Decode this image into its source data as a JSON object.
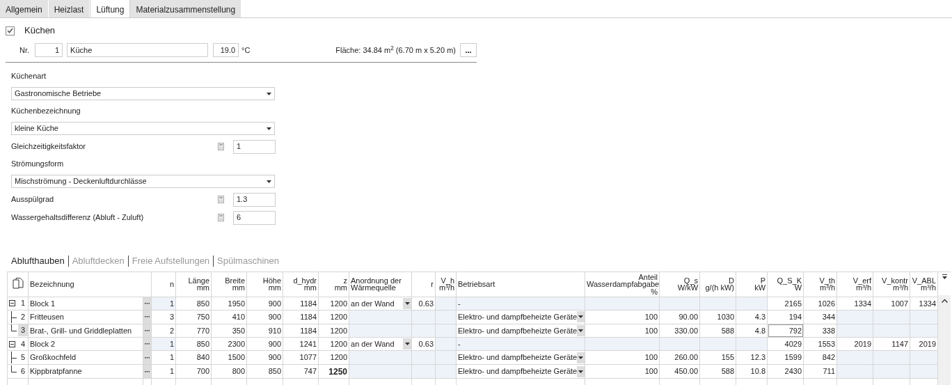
{
  "tabs": [
    {
      "label": "Allgemein",
      "selected": false
    },
    {
      "label": "Heizlast",
      "selected": false
    },
    {
      "label": "Lüftung",
      "selected": true
    },
    {
      "label": "Materialzusammenstellung",
      "selected": false
    }
  ],
  "room": {
    "checked": true,
    "title": "Küchen",
    "nr_label": "Nr.",
    "nr": "1",
    "name": "Küche",
    "temperature": "19.0",
    "temperature_unit": "°C",
    "area": "Fläche: 34.84  m$^{2}$ (6.70 m x 5.20 m)",
    "more_button": "..."
  },
  "fields": [
    {
      "kind": "select",
      "label": "Küchenart",
      "value": "Gastronomische Betriebe"
    },
    {
      "kind": "select",
      "label": "Küchenbezeichnung",
      "value": "kleine Küche"
    },
    {
      "kind": "number",
      "label": "Gleichzeitigkeitsfaktor",
      "value": "1"
    },
    {
      "kind": "select",
      "label": "Strömungsform",
      "value": "Mischströmung - Deckenluftdurchlässe"
    },
    {
      "kind": "number",
      "label": "Ausspülgrad",
      "value": "1.3"
    },
    {
      "kind": "number",
      "label": "Wassergehaltsdifferenz (Abluft - Zuluft)",
      "value": "6"
    }
  ],
  "subtabs": [
    {
      "label": "Ablufthauben",
      "selected": true
    },
    {
      "label": "Abluftdecken",
      "selected": false
    },
    {
      "label": "Freie Aufstellungen",
      "selected": false
    },
    {
      "label": "Spülmaschinen",
      "selected": false
    }
  ],
  "table": {
    "name_column": "Bezeichnung",
    "columns": [
      {
        "name": "n"
      },
      {
        "name": "Länge",
        "unit": "mm"
      },
      {
        "name": "Breite",
        "unit": "mm"
      },
      {
        "name": "Höhe",
        "unit": "mm"
      },
      {
        "name": "d_hydr",
        "unit": "mm"
      },
      {
        "name": "z",
        "unit": "mm"
      },
      {
        "name": "Anordnung der Wärmequelle"
      },
      {
        "name": "r"
      },
      {
        "name": "V_h",
        "unit": "m³/h"
      },
      {
        "name": "Betriebsart"
      },
      {
        "name": "Anteil Wasserdampfabgabe",
        "unit": "%"
      },
      {
        "name": "Q_s",
        "unit": "W/kW"
      },
      {
        "name": "D",
        "unit": "g/(h kW)"
      },
      {
        "name": "P",
        "unit": "kW"
      },
      {
        "name": "Q_S_K",
        "unit": "W"
      },
      {
        "name": "V_th",
        "unit": "m³/h"
      },
      {
        "name": "V_erf",
        "unit": "m³/h"
      },
      {
        "name": "V_kontr",
        "unit": "m³/h"
      },
      {
        "name": "V_ABL",
        "unit": "m³/h"
      }
    ],
    "rows": [
      {
        "nr": "1",
        "name": "Block 1",
        "expanded": true,
        "selected": false,
        "n": "1",
        "laenge": "850",
        "breite": "1950",
        "hoehe": "900",
        "d_hydr": "1184",
        "z": {
          "text": "1200",
          "bold": false
        },
        "anordnung": {
          "text": "an der Wand",
          "dropdown": true
        },
        "r": "0.63",
        "betriebsart": {
          "text": "-",
          "dropdown": false
        },
        "q_s_k": {
          "text": "2165",
          "focused": false
        },
        "v_th": "1026",
        "v_erf": "1334",
        "v_kontr": "1007",
        "v_abl": "1334",
        "children": [
          {
            "nr": "2",
            "name": "Fritteusen",
            "selected": false,
            "n": "3",
            "laenge": "750",
            "breite": "410",
            "hoehe": "900",
            "d_hydr": "1184",
            "z": {
              "text": "1200",
              "bold": false
            },
            "betriebsart": {
              "text": "Elektro- und dampfbeheizte Geräte",
              "dropdown": true
            },
            "anteil": "100",
            "q_s": "90.00",
            "d": "1030",
            "p": "4.3",
            "q_s_k": {
              "text": "194",
              "focused": false
            },
            "v_th": "344"
          },
          {
            "nr": "3",
            "name": "Brat-, Grill- und Griddleplatten",
            "selected": true,
            "n": "2",
            "laenge": "770",
            "breite": "350",
            "hoehe": "910",
            "d_hydr": "1184",
            "z": {
              "text": "1200",
              "bold": false
            },
            "betriebsart": {
              "text": "Elektro- und dampfbeheizte Geräte",
              "dropdown": true
            },
            "anteil": "100",
            "q_s": "330.00",
            "d": "588",
            "p": "4.8",
            "q_s_k": {
              "text": "792",
              "focused": true
            },
            "v_th": "338"
          }
        ]
      },
      {
        "nr": "4",
        "name": "Block 2",
        "expanded": true,
        "selected": false,
        "n": "1",
        "laenge": "850",
        "breite": "2300",
        "hoehe": "900",
        "d_hydr": "1241",
        "z": {
          "text": "1200",
          "bold": false
        },
        "anordnung": {
          "text": "an der Wand",
          "dropdown": true
        },
        "r": "0.63",
        "betriebsart": {
          "text": "-",
          "dropdown": false
        },
        "q_s_k": {
          "text": "4029",
          "focused": false
        },
        "v_th": "1553",
        "v_erf": "2019",
        "v_kontr": "1147",
        "v_abl": "2019",
        "children": [
          {
            "nr": "5",
            "name": "Großkochfeld",
            "selected": false,
            "n": "1",
            "laenge": "840",
            "breite": "1500",
            "hoehe": "900",
            "d_hydr": "1077",
            "z": {
              "text": "1200",
              "bold": false
            },
            "betriebsart": {
              "text": "Elektro- und dampfbeheizte Geräte",
              "dropdown": true
            },
            "anteil": "100",
            "q_s": "260.00",
            "d": "155",
            "p": "12.3",
            "q_s_k": {
              "text": "1599",
              "focused": false
            },
            "v_th": "842"
          },
          {
            "nr": "6",
            "name": "Kippbratpfanne",
            "selected": false,
            "n": "1",
            "laenge": "700",
            "breite": "800",
            "hoehe": "850",
            "d_hydr": "747",
            "z": {
              "text": "1250",
              "bold": true
            },
            "betriebsart": {
              "text": "Elektro- und dampfbeheizte Geräte",
              "dropdown": true
            },
            "anteil": "100",
            "q_s": "450.00",
            "d": "588",
            "p": "10.8",
            "q_s_k": {
              "text": "2430",
              "focused": false
            },
            "v_th": "711"
          }
        ]
      }
    ]
  }
}
